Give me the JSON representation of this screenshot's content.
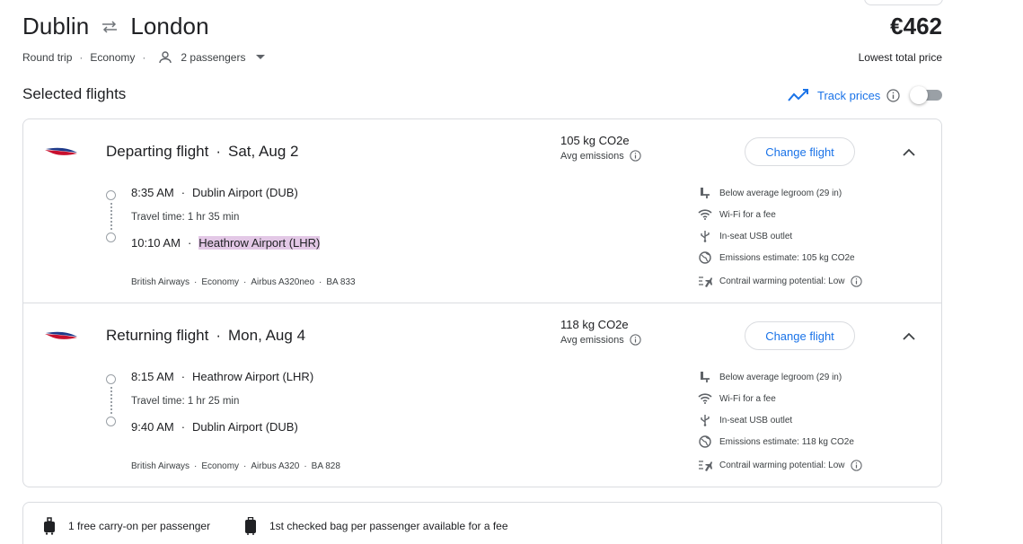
{
  "header": {
    "origin": "Dublin",
    "destination": "London",
    "price": "€462",
    "price_label": "Lowest total price",
    "trip_type": "Round trip",
    "cabin": "Economy",
    "passengers": "2 passengers"
  },
  "section_title": "Selected flights",
  "track_prices": {
    "label": "Track prices",
    "enabled": false
  },
  "colors": {
    "accent": "#1a73e8",
    "highlight": "#e3c8e6",
    "border": "#dadce0"
  },
  "flights": [
    {
      "direction": "Departing flight",
      "date": "Sat, Aug 2",
      "emissions": "105 kg CO2e",
      "emissions_label": "Avg emissions",
      "change_label": "Change flight",
      "depart_time": "8:35 AM",
      "depart_airport": "Dublin Airport (DUB)",
      "travel_time": "Travel time: 1 hr 35 min",
      "arrive_time": "10:10 AM",
      "arrive_airport": "Heathrow Airport (LHR)",
      "airline": "British Airways",
      "cabin": "Economy",
      "aircraft": "Airbus A320neo",
      "flight_number": "BA 833",
      "amenities": {
        "legroom": "Below average legroom (29 in)",
        "wifi": "Wi-Fi for a fee",
        "usb": "In-seat USB outlet",
        "emissions": "Emissions estimate: 105 kg CO2e",
        "contrail": "Contrail warming potential: Low"
      }
    },
    {
      "direction": "Returning flight",
      "date": "Mon, Aug 4",
      "emissions": "118 kg CO2e",
      "emissions_label": "Avg emissions",
      "change_label": "Change flight",
      "depart_time": "8:15 AM",
      "depart_airport": "Heathrow Airport (LHR)",
      "travel_time": "Travel time: 1 hr 25 min",
      "arrive_time": "9:40 AM",
      "arrive_airport": "Dublin Airport (DUB)",
      "airline": "British Airways",
      "cabin": "Economy",
      "aircraft": "Airbus A320",
      "flight_number": "BA 828",
      "amenities": {
        "legroom": "Below average legroom (29 in)",
        "wifi": "Wi-Fi for a fee",
        "usb": "In-seat USB outlet",
        "emissions": "Emissions estimate: 118 kg CO2e",
        "contrail": "Contrail warming potential: Low"
      }
    }
  ],
  "bags": {
    "carry_on": "1 free carry-on per passenger",
    "checked": "1st checked bag per passenger available for a fee"
  },
  "icons": {
    "swap": "swap-arrows-icon",
    "person": "person-icon",
    "trend": "trend-line-icon",
    "info": "info-icon",
    "airline": "british-airways-logo",
    "chevron": "chevron-up-icon",
    "legroom": "seat-icon",
    "wifi": "wifi-icon",
    "usb": "usb-icon",
    "globe": "globe-icon",
    "contrail": "contrail-icon",
    "carry_on": "carry-on-bag-icon",
    "checked": "checked-bag-icon"
  }
}
